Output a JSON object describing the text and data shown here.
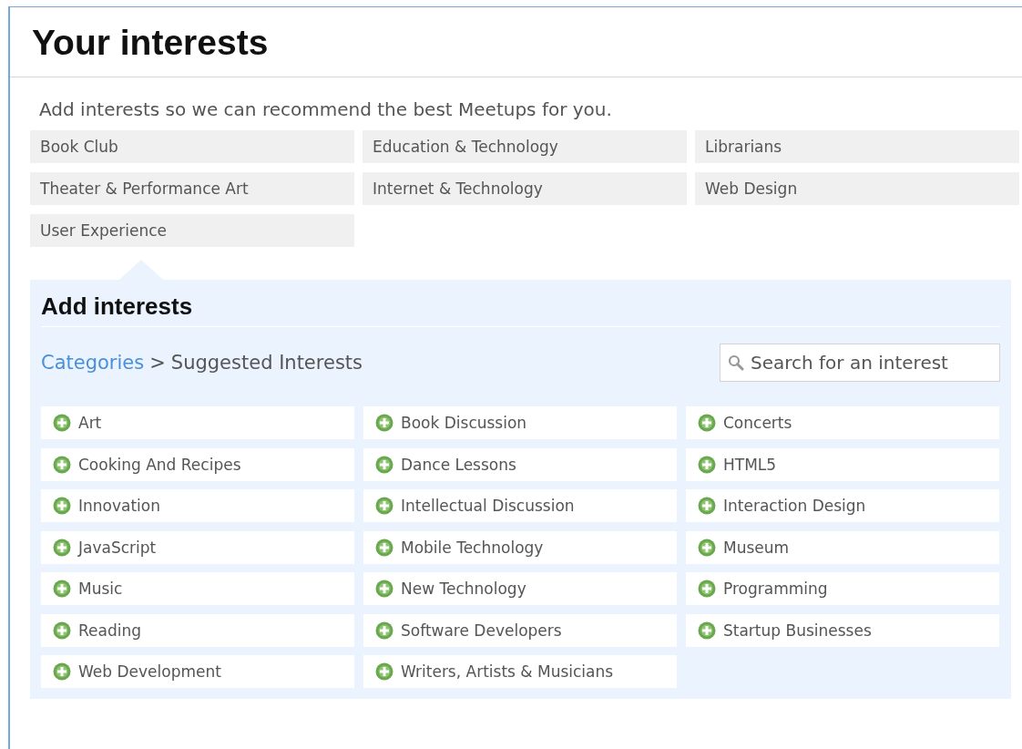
{
  "title": "Your interests",
  "intro": "Add interests so we can recommend the best Meetups for you.",
  "my_interests": [
    "Book Club",
    "Education & Technology",
    "Librarians",
    "Theater & Performance Art",
    "Internet & Technology",
    "Web Design",
    "User Experience"
  ],
  "add_panel": {
    "heading": "Add interests",
    "breadcrumb": {
      "link": "Categories",
      "separator": ">",
      "current": "Suggested Interests"
    },
    "search": {
      "placeholder": "Search for an interest"
    },
    "suggestions": [
      "Art",
      "Book Discussion",
      "Concerts",
      "Cooking And Recipes",
      "Dance Lessons",
      "HTML5",
      "Innovation",
      "Intellectual Discussion",
      "Interaction Design",
      "JavaScript",
      "Mobile Technology",
      "Museum",
      "Music",
      "New Technology",
      "Programming",
      "Reading",
      "Software Developers",
      "Startup Businesses",
      "Web Development",
      "Writers, Artists & Musicians"
    ]
  }
}
